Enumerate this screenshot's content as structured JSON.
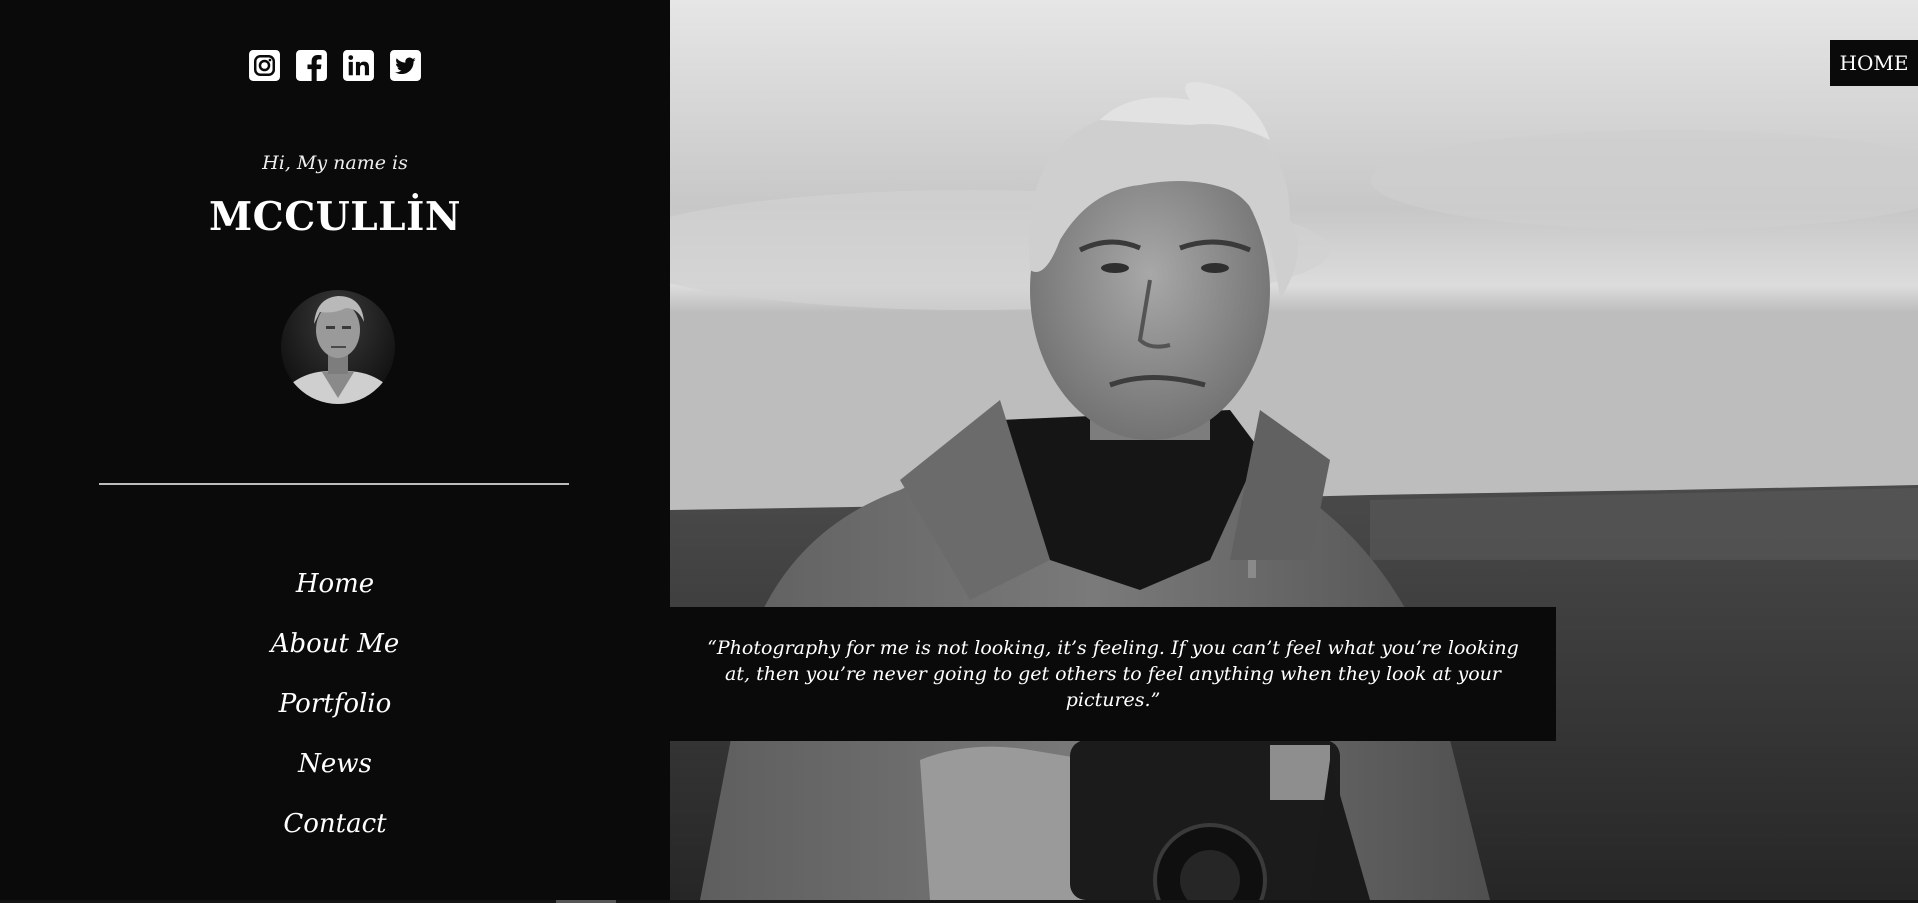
{
  "social": {
    "items": [
      {
        "name": "instagram-icon"
      },
      {
        "name": "facebook-icon"
      },
      {
        "name": "linkedin-icon"
      },
      {
        "name": "twitter-icon"
      }
    ]
  },
  "profile": {
    "greeting": "Hi, My name is",
    "name": "MCCULLİN"
  },
  "nav": {
    "items": [
      {
        "label": "Home"
      },
      {
        "label": "About Me"
      },
      {
        "label": "Portfolio"
      },
      {
        "label": "News"
      },
      {
        "label": "Contact"
      }
    ]
  },
  "header": {
    "home_label": "HOME"
  },
  "hero": {
    "quote": "“Photography for me is not looking, it’s feeling. If you can’t feel what you’re looking at, then you’re never going to get others to feel anything when they look at your pictures.”"
  },
  "colors": {
    "background": "#0a0a0a",
    "text": "#ffffff",
    "divider": "#bdbdbd"
  }
}
